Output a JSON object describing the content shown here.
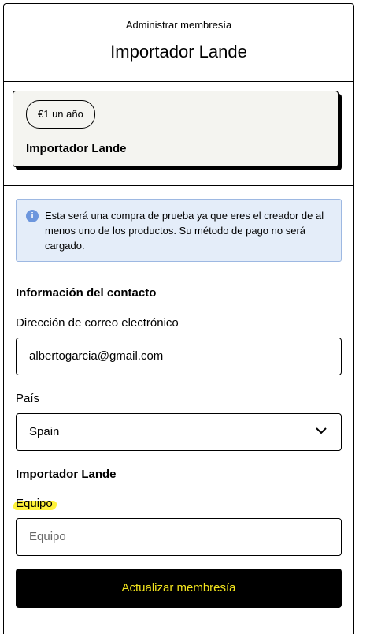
{
  "header": {
    "kicker": "Administrar membresía",
    "title": "Importador Lande"
  },
  "product_card": {
    "price": "€1 un año",
    "name": "Importador Lande"
  },
  "notice": {
    "icon": "info-icon",
    "text": "Esta será una compra de prueba ya que eres el creador de al menos uno de los productos. Su método de pago no será cargado."
  },
  "contact": {
    "heading": "Información del contacto",
    "email_label": "Dirección de correo electrónico",
    "email_value": "albertogarcia@gmail.com",
    "country_label": "País",
    "country_value": "Spain"
  },
  "product_section": {
    "heading": "Importador Lande",
    "team_label": "Equipo",
    "team_placeholder": "Equipo"
  },
  "actions": {
    "submit_label": "Actualizar membresía"
  },
  "colors": {
    "accent_button_text": "#f3e51d",
    "info_background": "#e4edf9",
    "highlight": "#fff23a"
  }
}
